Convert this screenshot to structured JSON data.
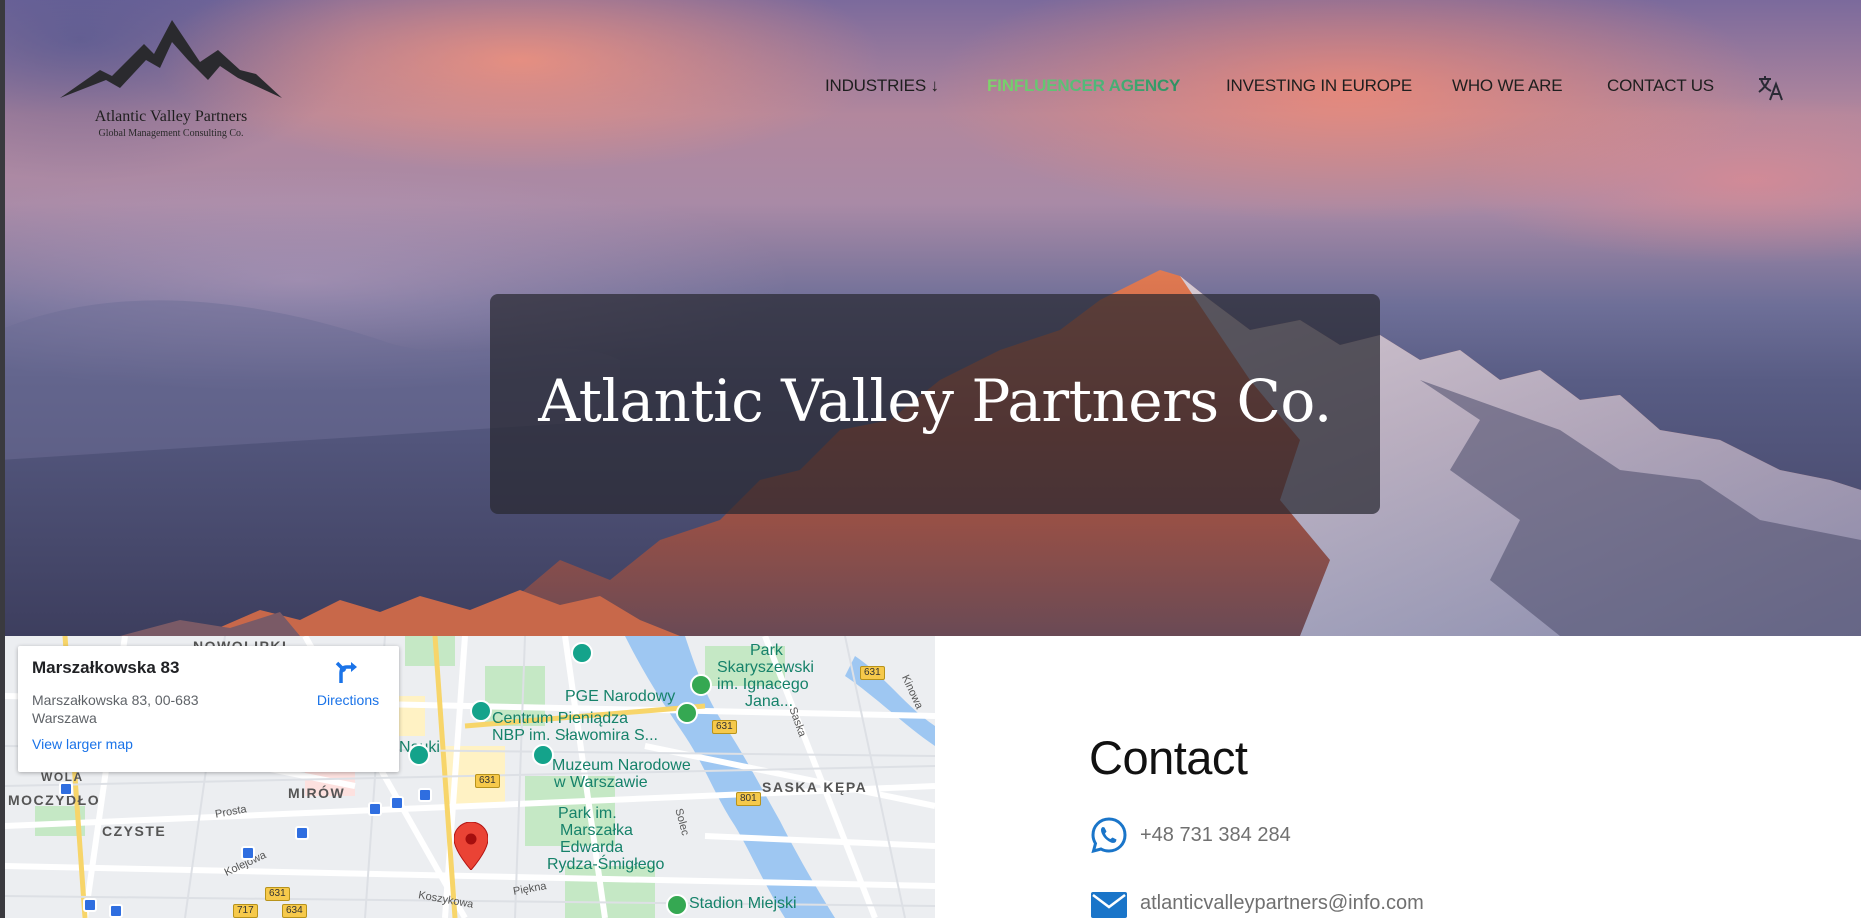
{
  "header": {
    "logo": {
      "name": "Atlantic Valley Partners",
      "tagline": "Global Management Consulting Co."
    },
    "nav": [
      {
        "label": "INDUSTRIES ↓"
      },
      {
        "label": "FINFLUENCER AGENCY",
        "active": true
      },
      {
        "label": "INVESTING IN EUROPE"
      },
      {
        "label": "WHO WE ARE"
      },
      {
        "label": "CONTACT US"
      }
    ],
    "translate_icon": "translate-icon"
  },
  "hero": {
    "title": "Atlantic Valley Partners Co."
  },
  "map": {
    "card": {
      "title": "Marszałkowska 83",
      "address_line1": "Marszałkowska 83, 00-683",
      "address_line2": "Warszawa",
      "directions_label": "Directions",
      "view_larger_label": "View larger map"
    },
    "labels": {
      "nowolipki": "NOWOLIPKI",
      "wola": "WOLA",
      "moczydlo": "MOCZYDŁO",
      "czyste": "CZYSTE",
      "mirow": "MIRÓW",
      "saska_kepa": "SASKA KĘPA",
      "nauki": "Nauki",
      "pge": "PGE Narodowy",
      "centrum_1": "Centrum Pieniądza",
      "centrum_2": "NBP im. Sławomira S...",
      "muzeum_1": "Muzeum Narodowe",
      "muzeum_2": "w Warszawie",
      "park_sk_1": "Park",
      "park_sk_2": "Skaryszewski",
      "park_sk_3": "im. Ignacego",
      "park_sk_4": "Jana...",
      "park_rs_1": "Park im.",
      "park_rs_2": "Marszałka",
      "park_rs_3": "Edwarda",
      "park_rs_4": "Rydza-Śmigłego",
      "stadion": "Stadion Miejski",
      "prosta": "Prosta",
      "kolejowa": "Kolejowa",
      "koszykowa": "Koszykowa",
      "piekna": "Piękna",
      "solec": "Solec",
      "saska": "Saska",
      "kinowa": "Kinowa",
      "r631a": "631",
      "r631b": "631",
      "r631c": "631",
      "r631d": "631",
      "r634a": "634",
      "r634b": "634",
      "r717": "717",
      "r801": "801"
    },
    "colors": {
      "water": "#9ec7f2",
      "park": "#c5e8c5",
      "road": "#ffffff",
      "marker": "#ea4335"
    }
  },
  "contact": {
    "title": "Contact",
    "phone": "+48 731 384 284",
    "email": "atlanticvalleypartners@info.com",
    "phone_icon": "whatsapp-icon",
    "email_icon": "mail-icon"
  },
  "colors": {
    "accent_start": "#7fd46a",
    "accent_end": "#2e8f62",
    "contact_icon": "#1a75c9"
  }
}
